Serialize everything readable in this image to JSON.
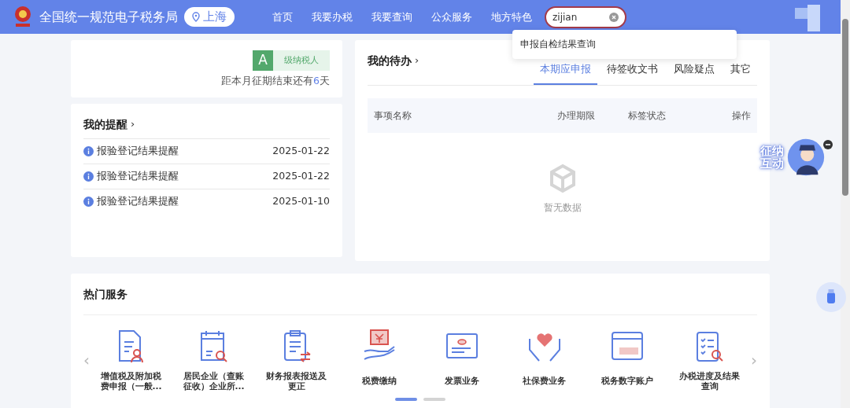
{
  "header": {
    "title": "全国统一规范电子税务局",
    "location": "上海",
    "nav": [
      {
        "label": "首页",
        "selected": false
      },
      {
        "label": "我要办税",
        "selected": false
      },
      {
        "label": "我要查询",
        "selected": false
      },
      {
        "label": "公众服务",
        "selected": false
      },
      {
        "label": "地方特色",
        "selected": false
      }
    ],
    "search": {
      "value": "zijian"
    },
    "suggestions": [
      "申报自检结果查询"
    ]
  },
  "taxpayer": {
    "grade": "A",
    "grade_label": "级纳税人",
    "deadline_prefix": "距本月征期结束还有",
    "days": "6",
    "deadline_suffix": "天"
  },
  "reminders": {
    "title": "我的提醒",
    "chevron": "›",
    "items": [
      {
        "text": "报验登记结果提醒",
        "date": "2025-01-22"
      },
      {
        "text": "报验登记结果提醒",
        "date": "2025-01-22"
      },
      {
        "text": "报验登记结果提醒",
        "date": "2025-01-10"
      }
    ]
  },
  "todo": {
    "title": "我的待办",
    "chevron": "›",
    "tabs": [
      {
        "label": "本期应申报",
        "selected": true
      },
      {
        "label": "待签收文书",
        "selected": false
      },
      {
        "label": "风险疑点",
        "selected": false
      },
      {
        "label": "其它",
        "selected": false
      }
    ],
    "columns": [
      "事项名称",
      "办理期限",
      "标签状态",
      "操作"
    ],
    "empty": "暂无数据"
  },
  "hot_services": {
    "title": "热门服务",
    "prev": "‹",
    "next": "›",
    "items": [
      {
        "label": "增值税及附加税费申报（一般...",
        "kind": "doc-person"
      },
      {
        "label": "居民企业（查账征收）企业所...",
        "kind": "calendar"
      },
      {
        "label": "财务报表报送及更正",
        "kind": "clipboard-swap"
      },
      {
        "label": "税费缴纳",
        "kind": "hand-yuan"
      },
      {
        "label": "发票业务",
        "kind": "invoice"
      },
      {
        "label": "社保费业务",
        "kind": "heart-hands"
      },
      {
        "label": "税务数字账户",
        "kind": "account"
      },
      {
        "label": "办税进度及结果查询",
        "kind": "checklist"
      }
    ],
    "pages": [
      {
        "selected": true
      },
      {
        "selected": false
      }
    ]
  },
  "assistant": {
    "label": "征纳互动"
  }
}
